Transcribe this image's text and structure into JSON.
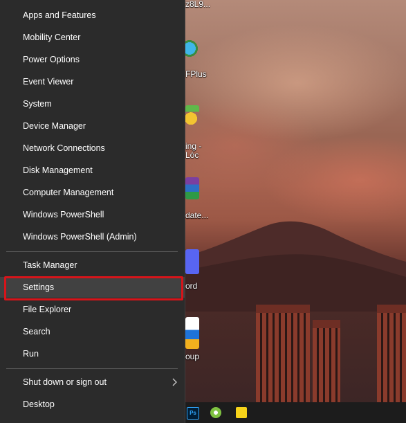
{
  "menu": {
    "items": [
      {
        "label": "Apps and Features"
      },
      {
        "label": "Mobility Center"
      },
      {
        "label": "Power Options"
      },
      {
        "label": "Event Viewer"
      },
      {
        "label": "System"
      },
      {
        "label": "Device Manager"
      },
      {
        "label": "Network Connections"
      },
      {
        "label": "Disk Management"
      },
      {
        "label": "Computer Management"
      },
      {
        "label": "Windows PowerShell"
      },
      {
        "label": "Windows PowerShell (Admin)"
      },
      {
        "label": "Task Manager"
      },
      {
        "label": "Settings"
      },
      {
        "label": "File Explorer"
      },
      {
        "label": "Search"
      },
      {
        "label": "Run"
      },
      {
        "label": "Shut down or sign out"
      },
      {
        "label": "Desktop"
      }
    ],
    "highlighted_item": "Settings",
    "highlight_color": "#d7141a",
    "menu_background": "#2b2b2b",
    "submenu_icon": "chevron-right-icon"
  },
  "desktop": {
    "icon_labels": [
      "z8L9...",
      "FPlus",
      "ing -",
      "Lóc",
      "date...",
      "ord",
      "oup"
    ],
    "icons": [
      "foxit-icon",
      "emoji-app-icon",
      "winrar-icon",
      "discord-icon",
      "update-shield-icon"
    ]
  },
  "taskbar": {
    "icons": [
      {
        "name": "photoshop-icon",
        "text": "Ps",
        "color": "#31a8ff"
      },
      {
        "name": "green-app-icon",
        "color": "#7fc241"
      },
      {
        "name": "sticky-notes-icon",
        "color": "#f7d31a"
      }
    ]
  }
}
